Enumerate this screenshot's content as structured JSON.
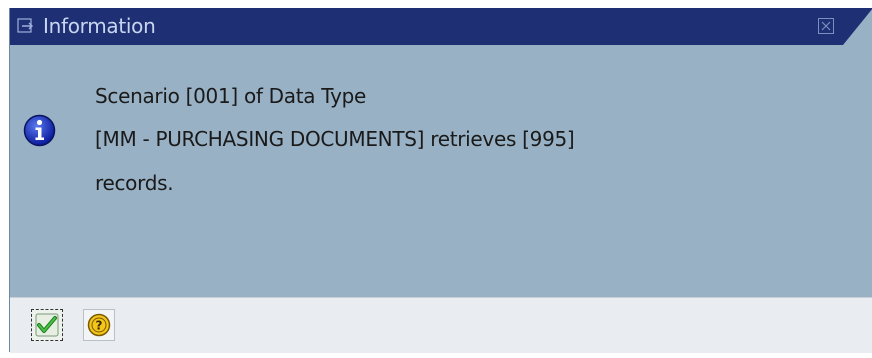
{
  "dialog": {
    "title": "Information",
    "icons": {
      "title": "info-window-icon",
      "close": "close-icon",
      "message": "info-icon"
    },
    "message": {
      "line1": "Scenario [001] of Data Type",
      "line2": "[MM - PURCHASING DOCUMENTS] retrieves [995]",
      "line3": "records."
    },
    "buttons": [
      {
        "name": "continue",
        "icon": "checkmark-icon"
      },
      {
        "name": "help",
        "icon": "help-icon"
      }
    ]
  },
  "colors": {
    "titlebar": "#1e2f74",
    "body": "#98b1c5",
    "footer": "#e9ecf0",
    "title_text": "#c9d6f0",
    "info_icon": "#1a2fb5",
    "checkmark": "#2e9a2e",
    "help_icon": "#f2c314"
  }
}
